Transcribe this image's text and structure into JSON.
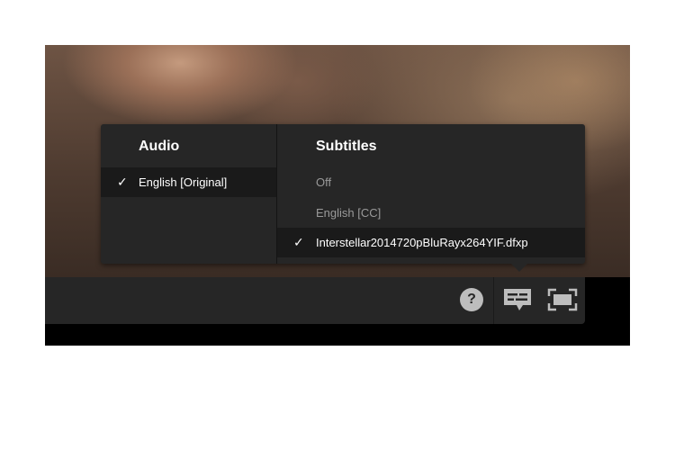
{
  "menu": {
    "audio": {
      "title": "Audio",
      "options": [
        {
          "label": "English [Original]",
          "selected": true
        }
      ]
    },
    "subtitles": {
      "title": "Subtitles",
      "options": [
        {
          "label": "Off",
          "selected": false
        },
        {
          "label": "English [CC]",
          "selected": false
        },
        {
          "label": "Interstellar2014720pBluRayx264YIF.dfxp",
          "selected": true
        }
      ]
    }
  },
  "controls": {
    "help_label": "?",
    "check_mark": "✓"
  },
  "icons": {
    "help": "help-icon",
    "subtitles": "subtitles-icon",
    "fullscreen": "fullscreen-icon",
    "check": "check-icon"
  },
  "colors": {
    "panel": "#262626",
    "selected_row": "#1a1a1a",
    "text_primary": "#ffffff",
    "text_muted": "#9a9a9a",
    "icon": "#bdbdbd"
  }
}
